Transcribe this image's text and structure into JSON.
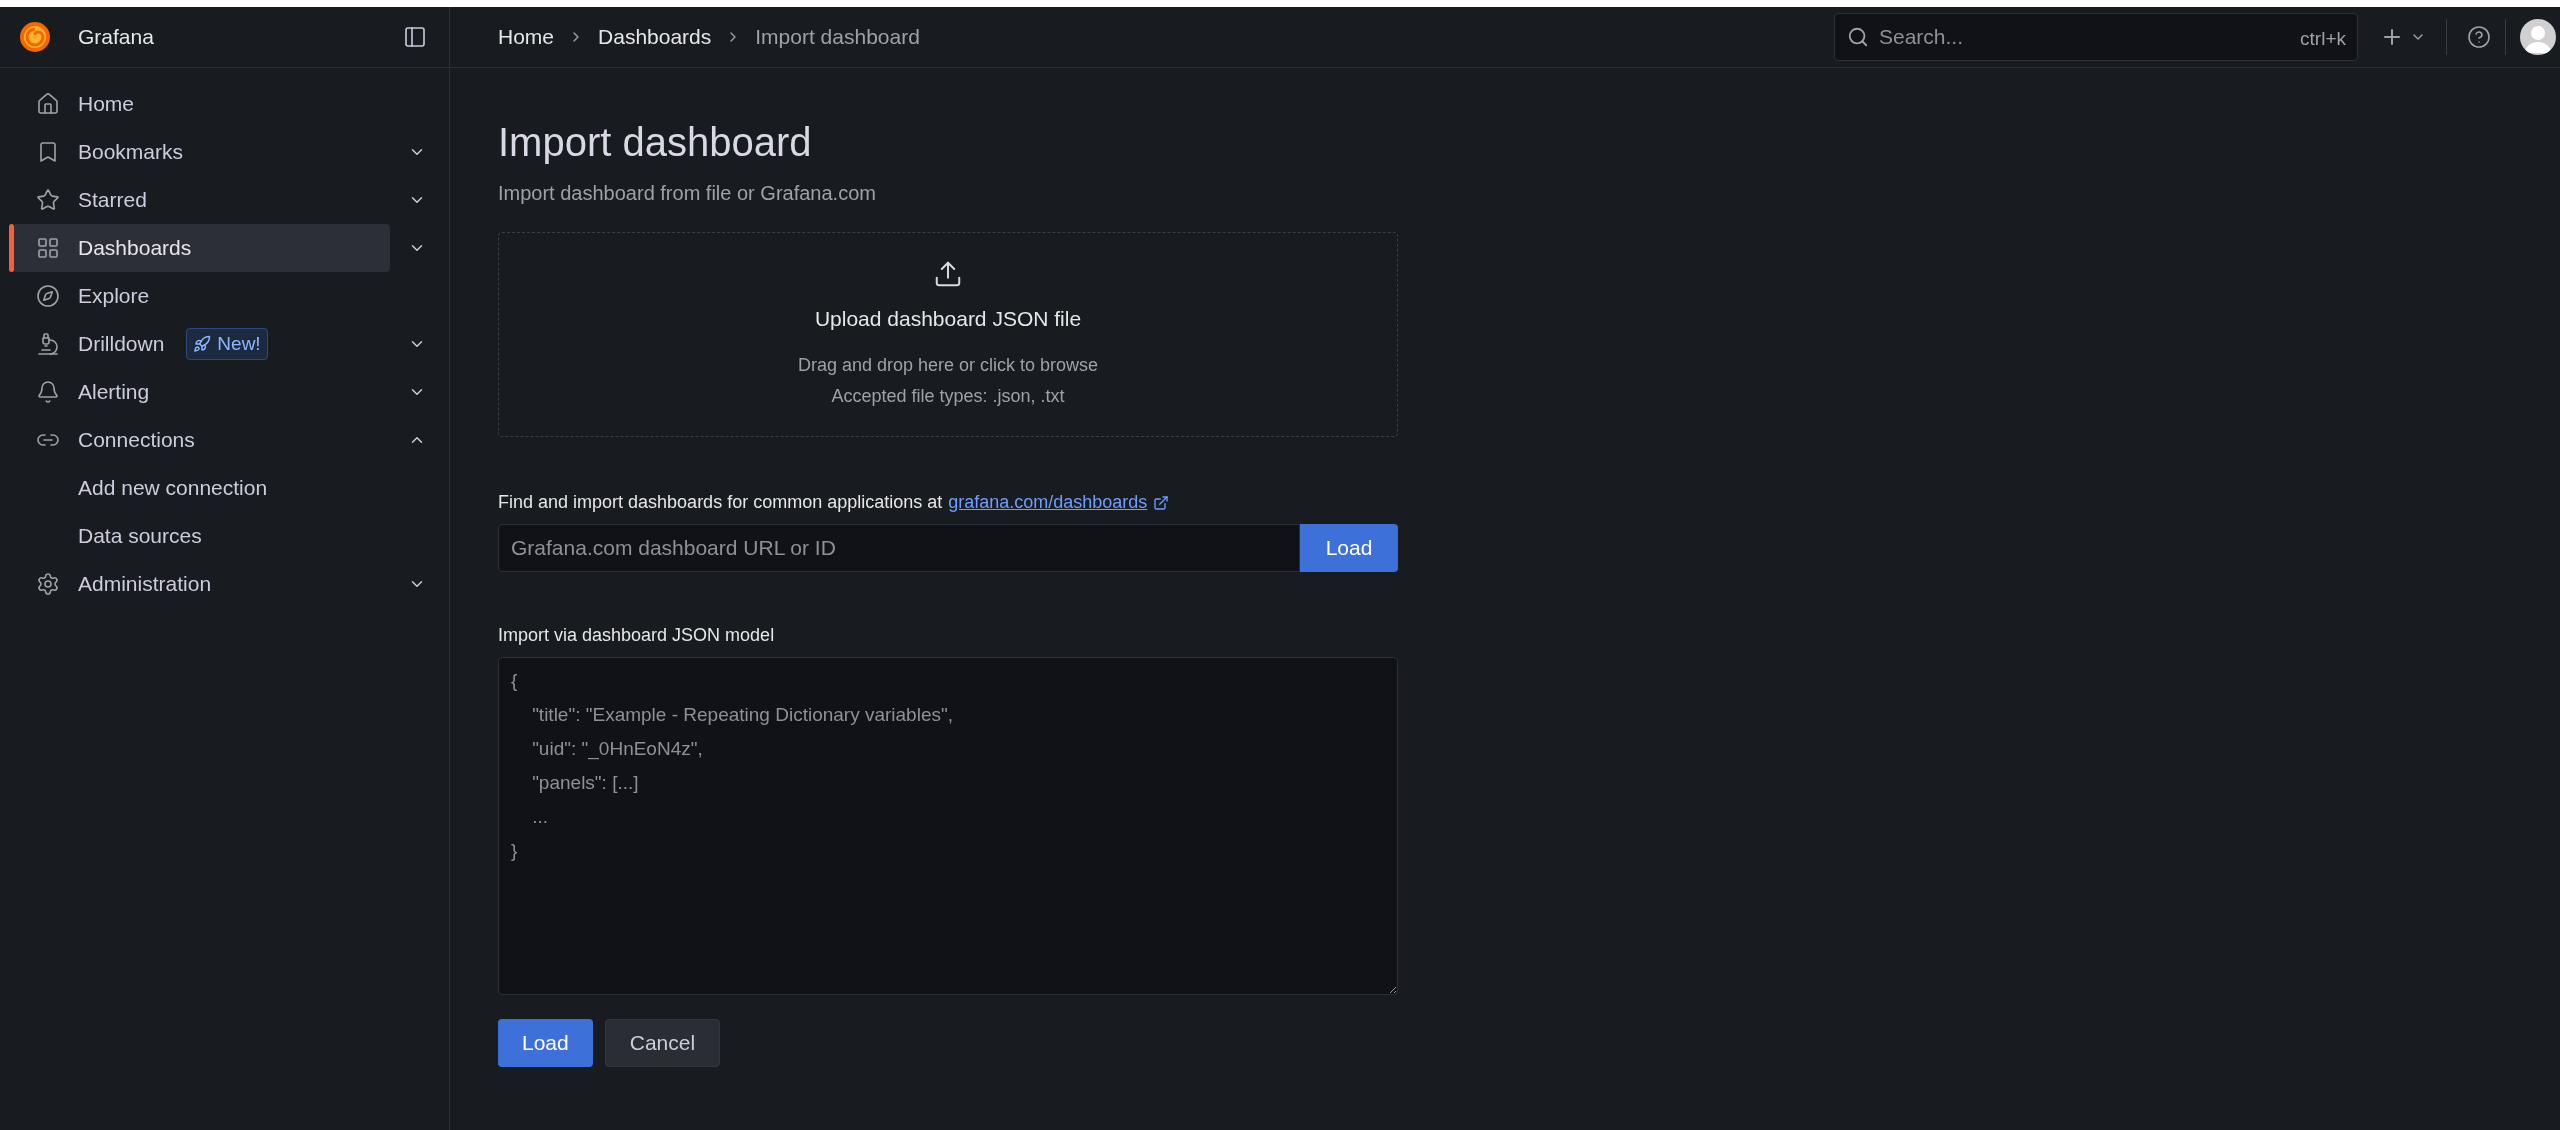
{
  "sidebar": {
    "brand": "Grafana",
    "items": [
      {
        "kind": "link",
        "label": "Home",
        "selected": false
      },
      {
        "kind": "group",
        "label": "Bookmarks",
        "selected": false,
        "expanded": false
      },
      {
        "kind": "group",
        "label": "Starred",
        "selected": false,
        "expanded": false
      },
      {
        "kind": "group",
        "label": "Dashboards",
        "selected": true,
        "expanded": false
      },
      {
        "kind": "link",
        "label": "Explore",
        "selected": false
      },
      {
        "kind": "group",
        "label": "Drilldown",
        "selected": false,
        "expanded": false,
        "badge": "New!"
      },
      {
        "kind": "group",
        "label": "Alerting",
        "selected": false,
        "expanded": false
      },
      {
        "kind": "group",
        "label": "Connections",
        "selected": false,
        "expanded": true,
        "children": [
          {
            "label": "Add new connection",
            "selected": false
          },
          {
            "label": "Data sources",
            "selected": false
          }
        ]
      },
      {
        "kind": "group",
        "label": "Administration",
        "selected": false,
        "expanded": false
      }
    ]
  },
  "breadcrumb": [
    {
      "label": "Home",
      "current": false
    },
    {
      "label": "Dashboards",
      "current": false
    },
    {
      "label": "Import dashboard",
      "current": true
    }
  ],
  "search": {
    "placeholder": "Search...",
    "shortcut": "ctrl+k"
  },
  "page": {
    "title": "Import dashboard",
    "subtitle": "Import dashboard from file or Grafana.com",
    "upload": {
      "title": "Upload dashboard JSON file",
      "hint": "Drag and drop here or click to browse",
      "types": "Accepted file types: .json, .txt"
    },
    "grafana_com": {
      "label": "Find and import dashboards for common applications at",
      "link": "grafana.com/dashboards",
      "placeholder": "Grafana.com dashboard URL or ID",
      "button": "Load"
    },
    "json_model": {
      "label": "Import via dashboard JSON model",
      "placeholder": "{\n    \"title\": \"Example - Repeating Dictionary variables\",\n    \"uid\": \"_0HnEoN4z\",\n    \"panels\": [...]\n    ...\n}"
    },
    "buttons": [
      {
        "kind": "primary",
        "label": "Load"
      },
      {
        "kind": "secondary",
        "label": "Cancel"
      }
    ]
  }
}
